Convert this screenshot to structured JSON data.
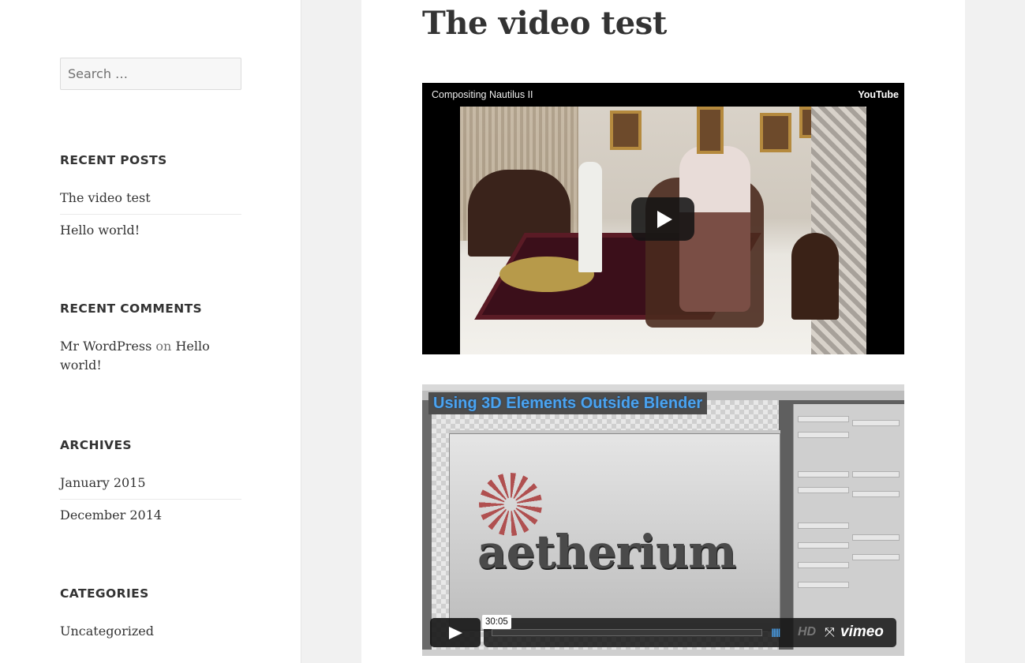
{
  "sidebar": {
    "search_placeholder": "Search …",
    "recent_posts": {
      "title": "RECENT POSTS",
      "items": [
        "The video test",
        "Hello world!"
      ]
    },
    "recent_comments": {
      "title": "RECENT COMMENTS",
      "author": "Mr WordPress",
      "on": "on",
      "post": "Hello world!"
    },
    "archives": {
      "title": "ARCHIVES",
      "items": [
        "January 2015",
        "December 2014"
      ]
    },
    "categories": {
      "title": "CATEGORIES",
      "items": [
        "Uncategorized"
      ]
    }
  },
  "post": {
    "title": "The video test"
  },
  "youtube": {
    "video_title": "Compositing Nautilus II",
    "brand": "YouTube"
  },
  "vimeo": {
    "banner": "Using 3D Elements Outside Blender",
    "logo_text": "aetherium",
    "time": "30:05",
    "hd": "HD",
    "volume_icon": "IIIII",
    "fullscreen_icon": "⤧",
    "brand": "vimeo"
  },
  "colors": {
    "accent_blue": "#4aa3f0",
    "background": "#f1f1f1",
    "text": "#333333"
  }
}
